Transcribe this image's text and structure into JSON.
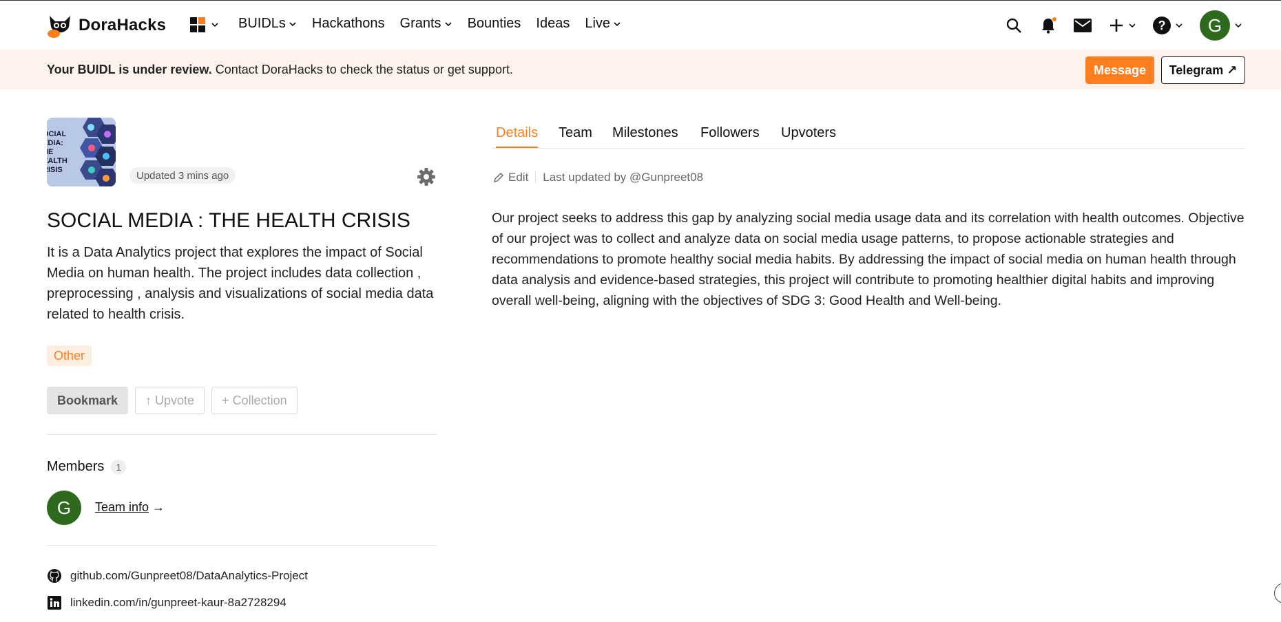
{
  "brand": {
    "name": "DoraHacks"
  },
  "nav": {
    "items": [
      {
        "label": "BUIDLs",
        "dropdown": true
      },
      {
        "label": "Hackathons",
        "dropdown": false
      },
      {
        "label": "Grants",
        "dropdown": true
      },
      {
        "label": "Bounties",
        "dropdown": false
      },
      {
        "label": "Ideas",
        "dropdown": false
      },
      {
        "label": "Live",
        "dropdown": true
      }
    ],
    "avatar_initial": "G"
  },
  "banner": {
    "bold": "Your BUIDL is under review.",
    "text": " Contact DoraHacks to check the status or get support.",
    "message_label": "Message",
    "telegram_label": "Telegram ↗"
  },
  "project": {
    "thumb_text": "OCIAL\nEDIA:\nHE\nEALTH\nRISIS",
    "updated": "Updated 3 mins ago",
    "title": "SOCIAL MEDIA : THE HEALTH CRISIS",
    "description": "It is a Data Analytics project that explores the impact of Social Media on human health. The project includes data collection , preprocessing , analysis and visualizations of social media data related to health crisis.",
    "tag": "Other",
    "bookmark_label": "Bookmark",
    "upvote_label": "↑ Upvote",
    "collection_label": "+ Collection"
  },
  "members": {
    "label": "Members",
    "count": "1",
    "avatar_initial": "G",
    "team_info_label": "Team info",
    "team_info_arrow": " →"
  },
  "links": {
    "github": "github.com/Gunpreet08/DataAnalytics-Project",
    "linkedin": "linkedin.com/in/gunpreet-kaur-8a2728294"
  },
  "tabs": [
    "Details",
    "Team",
    "Milestones",
    "Followers",
    "Upvoters"
  ],
  "details": {
    "edit_label": "Edit",
    "last_updated": "Last updated by @Gunpreet08",
    "body": "Our project seeks to address this gap by analyzing social media usage data and its correlation with health outcomes. Objective of our project was to collect and analyze data on social media usage patterns, to propose actionable strategies and recommendations to promote healthy social media habits. By addressing the impact of social media on human health through data analysis and evidence-based strategies, this project will contribute to promoting healthier digital habits and improving overall well-being, aligning with the objectives of SDG 3: Good Health and Well-being."
  },
  "colors": {
    "accent": "#ff7f1e",
    "avatar_green": "#2d6a1e",
    "banner_bg": "#fdf3ec"
  },
  "icons": [
    "dorahacks-logo-icon",
    "apps-grid-icon",
    "search-icon",
    "bell-icon",
    "mail-icon",
    "plus-icon",
    "help-icon",
    "gear-icon",
    "pencil-icon",
    "github-icon",
    "linkedin-icon"
  ]
}
